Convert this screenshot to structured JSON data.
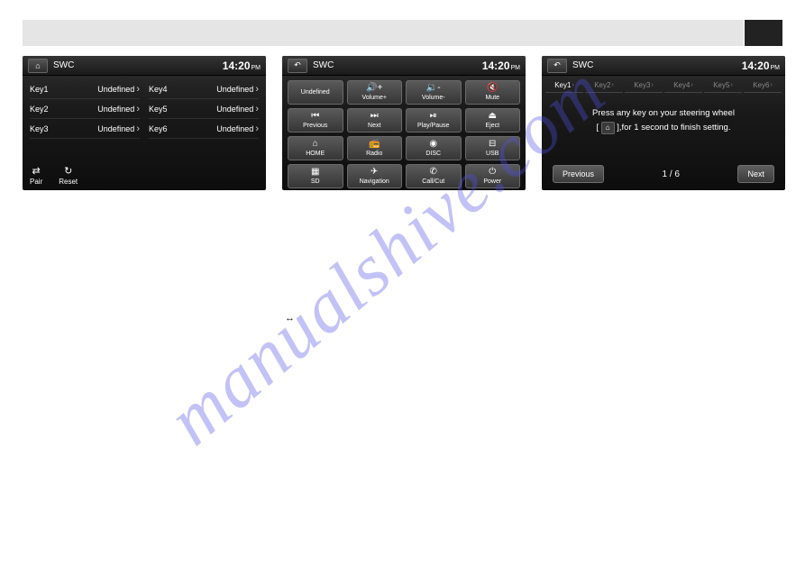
{
  "watermark": "manualshive.com",
  "header_time": "14:20",
  "header_ampm": "PM",
  "screen1": {
    "title": "SWC",
    "keys": [
      {
        "label": "Key1",
        "value": "Undefined"
      },
      {
        "label": "Key2",
        "value": "Undefined"
      },
      {
        "label": "Key3",
        "value": "Undefined"
      },
      {
        "label": "Key4",
        "value": "Undefined"
      },
      {
        "label": "Key5",
        "value": "Undefined"
      },
      {
        "label": "Key6",
        "value": "Undefined"
      }
    ],
    "pair": "Pair",
    "reset": "Reset"
  },
  "screen2": {
    "title": "SWC",
    "buttons": [
      {
        "label": "Undefined"
      },
      {
        "icon": "🔊+",
        "label": "Volume+"
      },
      {
        "icon": "🔉-",
        "label": "Volume-"
      },
      {
        "icon": "🔇",
        "label": "Mute"
      },
      {
        "icon": "",
        "label": ""
      },
      {
        "icon": "⏮",
        "label": "Previous"
      },
      {
        "icon": "⏭",
        "label": "Next"
      },
      {
        "icon": "⏯",
        "label": "Play/Pause"
      },
      {
        "icon": "⏏",
        "label": "Eject"
      },
      {
        "icon": "",
        "label": ""
      },
      {
        "icon": "⌂",
        "label": "HOME"
      },
      {
        "icon": "📻",
        "label": "Radio"
      },
      {
        "icon": "◉",
        "label": "DISC"
      },
      {
        "icon": "⊟",
        "label": "USB"
      },
      {
        "icon": "",
        "label": ""
      },
      {
        "icon": "▦",
        "label": "SD"
      },
      {
        "icon": "✈",
        "label": "Navigation"
      },
      {
        "icon": "✆",
        "label": "Call/Cut"
      },
      {
        "icon": "⏻",
        "label": "Power"
      },
      {
        "icon": "",
        "label": ""
      }
    ]
  },
  "screen3": {
    "title": "SWC",
    "tabs": [
      "Key1",
      "Key2",
      "Key3",
      "Key4",
      "Key5",
      "Key6"
    ],
    "active_tab": 0,
    "msg_line1": "Press any key on your steering wheel",
    "msg_line2_prefix": "[",
    "msg_line2_home": "⌂",
    "msg_line2_suffix": "],for 1 second to finish setting.",
    "prev": "Previous",
    "page": "1 / 6",
    "next": "Next"
  },
  "mid_glyph": "↔"
}
